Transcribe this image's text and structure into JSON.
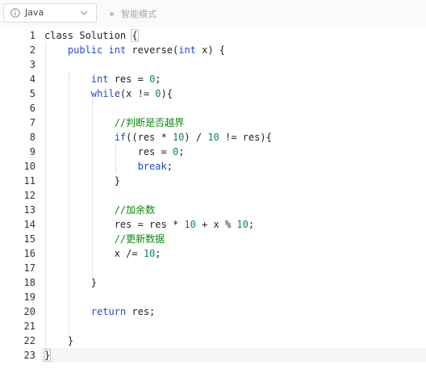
{
  "toolbar": {
    "language": "Java",
    "mode_label": "智能模式"
  },
  "editor": {
    "lines": [
      [
        [
          "p",
          "class Solution "
        ],
        [
          "b",
          "{"
        ]
      ],
      [
        [
          "p",
          "    "
        ],
        [
          "k",
          "public"
        ],
        [
          "p",
          " "
        ],
        [
          "k",
          "int"
        ],
        [
          "p",
          " reverse("
        ],
        [
          "k",
          "int"
        ],
        [
          "p",
          " x) {"
        ]
      ],
      [],
      [
        [
          "p",
          "        "
        ],
        [
          "k",
          "int"
        ],
        [
          "p",
          " res = "
        ],
        [
          "n",
          "0"
        ],
        [
          "p",
          ";"
        ]
      ],
      [
        [
          "p",
          "        "
        ],
        [
          "k",
          "while"
        ],
        [
          "p",
          "(x != "
        ],
        [
          "n",
          "0"
        ],
        [
          "p",
          "){"
        ]
      ],
      [],
      [
        [
          "p",
          "            "
        ],
        [
          "c",
          "//判断是否越界"
        ]
      ],
      [
        [
          "p",
          "            "
        ],
        [
          "k",
          "if"
        ],
        [
          "p",
          "((res * "
        ],
        [
          "n",
          "10"
        ],
        [
          "p",
          ") / "
        ],
        [
          "n",
          "10"
        ],
        [
          "p",
          " != res){"
        ]
      ],
      [
        [
          "p",
          "                res = "
        ],
        [
          "n",
          "0"
        ],
        [
          "p",
          ";"
        ]
      ],
      [
        [
          "p",
          "                "
        ],
        [
          "k",
          "break"
        ],
        [
          "p",
          ";"
        ]
      ],
      [
        [
          "p",
          "            }"
        ]
      ],
      [],
      [
        [
          "p",
          "            "
        ],
        [
          "c",
          "//加余数"
        ]
      ],
      [
        [
          "p",
          "            res = res * "
        ],
        [
          "n",
          "10"
        ],
        [
          "p",
          " + x % "
        ],
        [
          "n",
          "10"
        ],
        [
          "p",
          ";"
        ]
      ],
      [
        [
          "p",
          "            "
        ],
        [
          "c",
          "//更新数据"
        ]
      ],
      [
        [
          "p",
          "            x /= "
        ],
        [
          "n",
          "10"
        ],
        [
          "p",
          ";"
        ]
      ],
      [],
      [
        [
          "p",
          "        }"
        ]
      ],
      [],
      [
        [
          "p",
          "        "
        ],
        [
          "k",
          "return"
        ],
        [
          "p",
          " res;"
        ]
      ],
      [],
      [
        [
          "p",
          "    }"
        ]
      ],
      [
        [
          "b",
          "}"
        ]
      ]
    ]
  }
}
